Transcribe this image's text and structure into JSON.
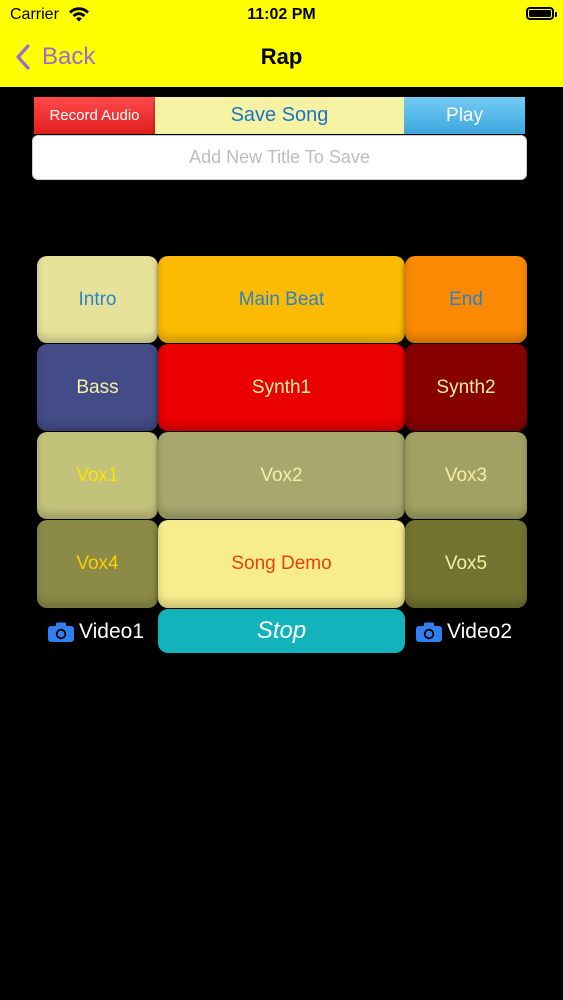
{
  "status_bar": {
    "carrier": "Carrier",
    "time": "11:02 PM"
  },
  "nav": {
    "back_label": "Back",
    "title": "Rap"
  },
  "toolbar": {
    "record_label": "Record Audio",
    "save_label": "Save Song",
    "play_label": "Play"
  },
  "title_input": {
    "placeholder": "Add New Title To Save",
    "value": ""
  },
  "pads": {
    "intro": "Intro",
    "main_beat": "Main Beat",
    "end": "End",
    "bass": "Bass",
    "synth1": "Synth1",
    "synth2": "Synth2",
    "vox1": "Vox1",
    "vox2": "Vox2",
    "vox3": "Vox3",
    "vox4": "Vox4",
    "song_demo": "Song Demo",
    "vox5": "Vox5"
  },
  "pad_colors": {
    "intro": {
      "bg": "#e7e29a",
      "fg": "#2c82c9"
    },
    "main_beat": {
      "bg": "#fcbb02",
      "fg": "#2c82c9"
    },
    "end": {
      "bg": "#fb8903",
      "fg": "#2c82c9"
    },
    "bass": {
      "bg": "#434c86",
      "fg": "#f4f0a6"
    },
    "synth1": {
      "bg": "#ea0000",
      "fg": "#f4f0a6"
    },
    "synth2": {
      "bg": "#860000",
      "fg": "#f4f0a6"
    },
    "vox1": {
      "bg": "#c3c27a",
      "fg": "#fbe400"
    },
    "vox2": {
      "bg": "#a7a76e",
      "fg": "#f4f0a6"
    },
    "vox3": {
      "bg": "#a2a162",
      "fg": "#f4f0a6"
    },
    "vox4": {
      "bg": "#8b8b47",
      "fg": "#fbd000"
    },
    "song_demo": {
      "bg": "#f7ed8d",
      "fg": "#e5430a"
    },
    "vox5": {
      "bg": "#71732f",
      "fg": "#f4f0a6"
    }
  },
  "controls": {
    "video1_label": "Video1",
    "stop_label": "Stop",
    "video2_label": "Video2"
  },
  "icons": {
    "back": "chevron-left-icon",
    "wifi": "wifi-icon",
    "battery": "battery-icon",
    "camera": "camera-icon"
  },
  "colors": {
    "header_bg": "#ffff00",
    "back_accent": "#9b6bd1",
    "stop_bg": "#13b3bb",
    "camera_icon": "#2f7ff0"
  }
}
